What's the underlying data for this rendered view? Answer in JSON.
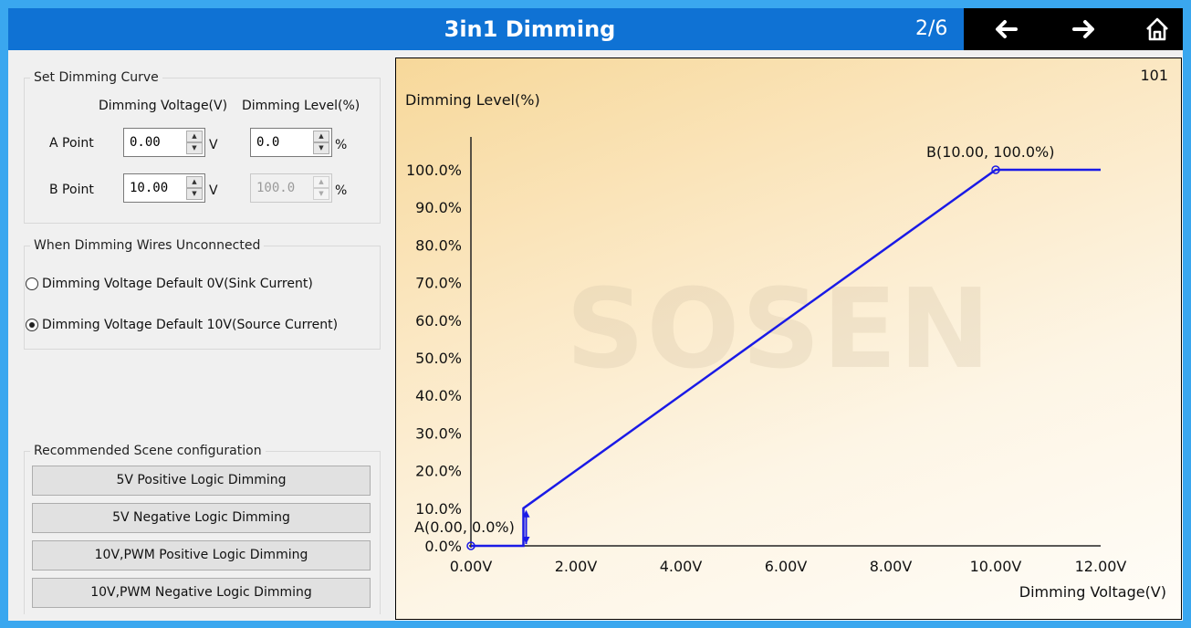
{
  "titlebar": {
    "title": "3in1 Dimming",
    "page_indicator": "2/6",
    "colors": {
      "bar": "#0f72d4",
      "nav_bg": "#000000"
    },
    "icons": [
      "arrow-left-icon",
      "arrow-right-icon",
      "home-icon"
    ]
  },
  "curve": {
    "group_title": "Set Dimming Curve",
    "col_voltage": "Dimming Voltage(V)",
    "col_level": "Dimming Level(%)",
    "a_label": "A Point",
    "b_label": "B Point",
    "a_voltage": "0.00",
    "a_level": "0.0",
    "b_voltage": "10.00",
    "b_level": "100.0",
    "unit_v": "V",
    "unit_pct": "%"
  },
  "unconnected": {
    "group_title": "When Dimming Wires Unconnected",
    "option_sink": "Dimming Voltage Default 0V(Sink Current)",
    "option_source": "Dimming Voltage Default 10V(Source Current)",
    "selected": "source"
  },
  "scene": {
    "group_title": "Recommended Scene configuration",
    "buttons": [
      "5V Positive Logic Dimming",
      "5V Negative Logic Dimming",
      "10V,PWM Positive Logic Dimming",
      "10V,PWM Negative Logic Dimming"
    ]
  },
  "chart": {
    "id_label": "101",
    "watermark": "SOSEN",
    "point_a_label": "A(0.00, 0.0%)",
    "point_b_label": "B(10.00, 100.0%)"
  },
  "chart_data": {
    "type": "line",
    "title": "",
    "xlabel": "Dimming Voltage(V)",
    "ylabel": "Dimming Level(%)",
    "xlim": [
      0,
      12
    ],
    "ylim": [
      0,
      100
    ],
    "x_ticks": [
      "0.00V",
      "2.00V",
      "4.00V",
      "6.00V",
      "8.00V",
      "10.00V",
      "12.00V"
    ],
    "y_ticks": [
      "0.0%",
      "10.0%",
      "20.0%",
      "30.0%",
      "40.0%",
      "50.0%",
      "60.0%",
      "70.0%",
      "80.0%",
      "90.0%",
      "100.0%"
    ],
    "series": [
      {
        "color": "#1a1ae6",
        "points": [
          [
            0,
            0
          ],
          [
            1,
            0
          ],
          [
            1,
            10
          ],
          [
            10,
            100
          ],
          [
            12,
            100
          ]
        ]
      }
    ],
    "markers": [
      [
        0,
        0
      ],
      [
        10,
        100
      ]
    ],
    "grid": false,
    "legend": "none"
  }
}
